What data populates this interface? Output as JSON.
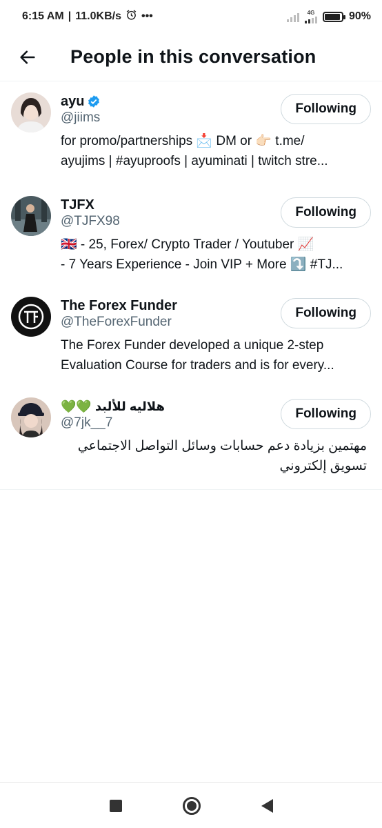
{
  "status_bar": {
    "time": "6:15 AM",
    "speed": "11.0KB/s",
    "alarm_icon": "alarm-clock-icon",
    "more": "•••",
    "network": "4G",
    "battery": "90%",
    "battery_level": 0.9
  },
  "header": {
    "back_icon": "arrow-left-icon",
    "title": "People in this conversation"
  },
  "people": [
    {
      "name": "ayu",
      "verified": true,
      "handle": "@jiims",
      "button": "Following",
      "bio_lines": [
        "for promo/partnerships 📩 DM or 👉🏻 t.me/",
        "ayujims | #ayuproofs | ayuminati | twitch stre..."
      ],
      "avatar_color": "#d9c8c2"
    },
    {
      "name": "TJFX",
      "verified": false,
      "handle": "@TJFX98",
      "button": "Following",
      "bio_lines": [
        "🇬🇧 - 25, Forex/ Crypto Trader / Youtuber 📈",
        "- 7 Years Experience - Join VIP + More ⤵️ #TJ..."
      ],
      "avatar_color": "#3a4a4f"
    },
    {
      "name": "The Forex Funder",
      "verified": false,
      "handle": "@TheForexFunder",
      "button": "Following",
      "bio_lines": [
        "The Forex Funder developed a unique 2-step",
        "Evaluation Course for traders and is for every..."
      ],
      "avatar_color": "#111111"
    },
    {
      "name": "هلاليه للألبد 💚💚",
      "verified": false,
      "handle": "@7jk__7",
      "button": "Following",
      "bio_lines": [
        "مهتمين بزيادة دعم حسابات وسائل التواصل الاجتماعي",
        "تسويق إلكتروني"
      ],
      "avatar_color": "#c9b3a6"
    }
  ],
  "nav_bar": {
    "recents_icon": "square-recents-icon",
    "home_icon": "circle-home-icon",
    "back_icon": "triangle-back-icon"
  },
  "colors": {
    "text": "#0f1419",
    "secondary": "#536471",
    "verified": "#1d9bf0",
    "border": "#cfd9de"
  }
}
